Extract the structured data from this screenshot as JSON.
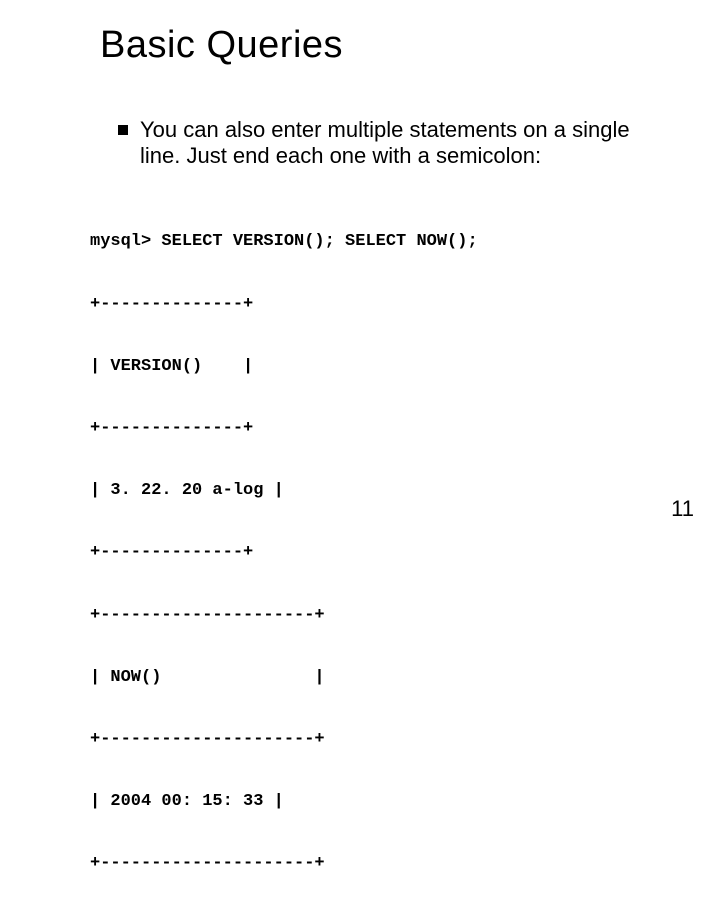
{
  "title": "Basic Queries",
  "bullet": "You can also enter multiple statements on a single line. Just end each one with a semicolon:",
  "code": [
    "mysql> SELECT VERSION(); SELECT NOW();",
    "+--------------+",
    "| VERSION()    |",
    "+--------------+",
    "| 3. 22. 20 a-log |",
    "+--------------+",
    "+---------------------+",
    "| NOW()               |",
    "+---------------------+",
    "| 2004 00: 15: 33 |",
    "+---------------------+"
  ],
  "page_number": "11"
}
